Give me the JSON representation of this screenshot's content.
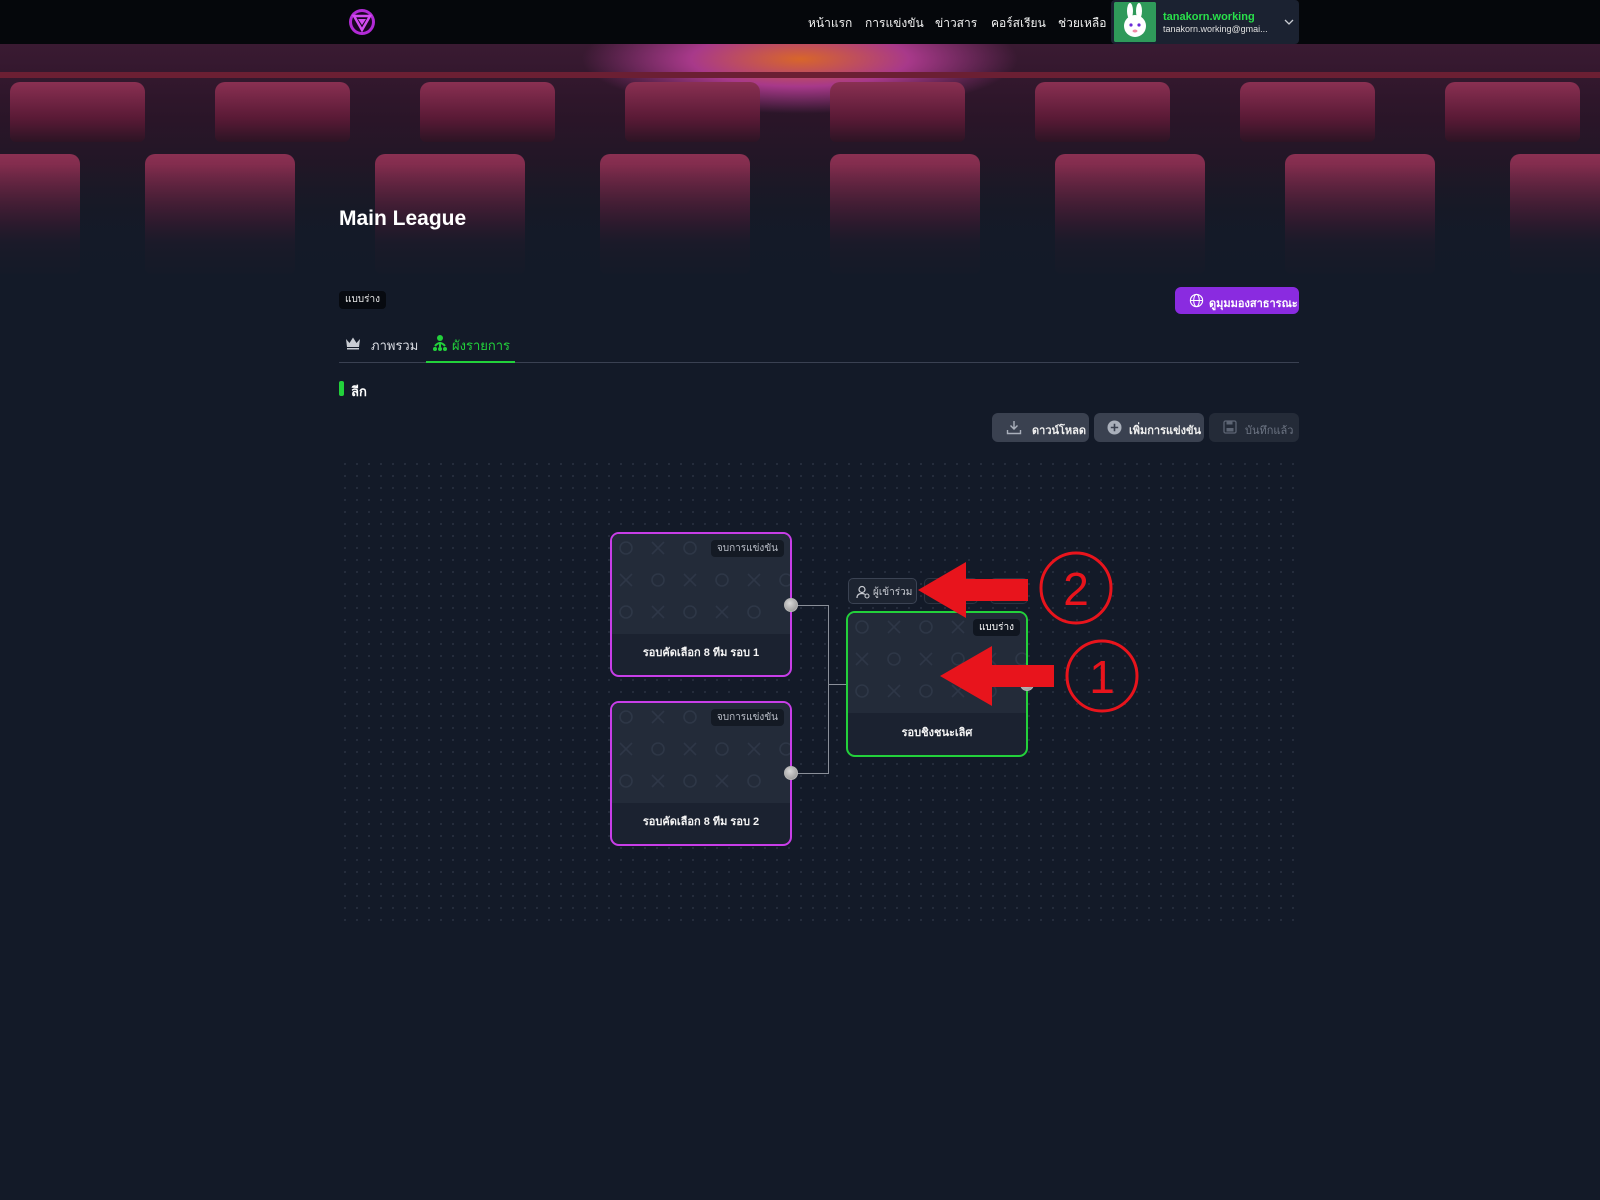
{
  "nav": {
    "links": [
      "หน้าแรก",
      "การแข่งขัน",
      "ข่าวสาร",
      "คอร์สเรียน",
      "ช่วยเหลือ"
    ],
    "user_name": "tanakorn.working",
    "user_email": "tanakorn.working@gmai..."
  },
  "page": {
    "title": "Main League",
    "status": "แบบร่าง",
    "public_button": "ดูมุมมองสาธารณะ"
  },
  "tabs": {
    "overview": "ภาพรวม",
    "bracket": "ผังรายการ"
  },
  "section": {
    "label": "ลีก"
  },
  "toolbar": {
    "download": "ดาวน์โหลด",
    "add_match": "เพิ่มการแข่งขัน",
    "saved": "บันทึกแล้ว"
  },
  "bracket": {
    "matches": [
      {
        "badge": "จบการแข่งขัน",
        "name": "รอบคัดเลือก 8 ทีม รอบ 1"
      },
      {
        "badge": "จบการแข่งขัน",
        "name": "รอบคัดเลือก 8 ทีม รอบ 2"
      },
      {
        "badge": "แบบร่าง",
        "name": "รอบชิงชนะเลิศ"
      }
    ],
    "participants_button": "ผู้เข้าร่วม"
  },
  "annotations": {
    "marker_1": "1",
    "marker_2": "2"
  },
  "colors": {
    "accent_green": "#22d13b",
    "accent_purple": "#8a2be0",
    "match_border_pink": "#c83ee8",
    "annotation_red": "#e8141c",
    "background": "#131a28"
  }
}
